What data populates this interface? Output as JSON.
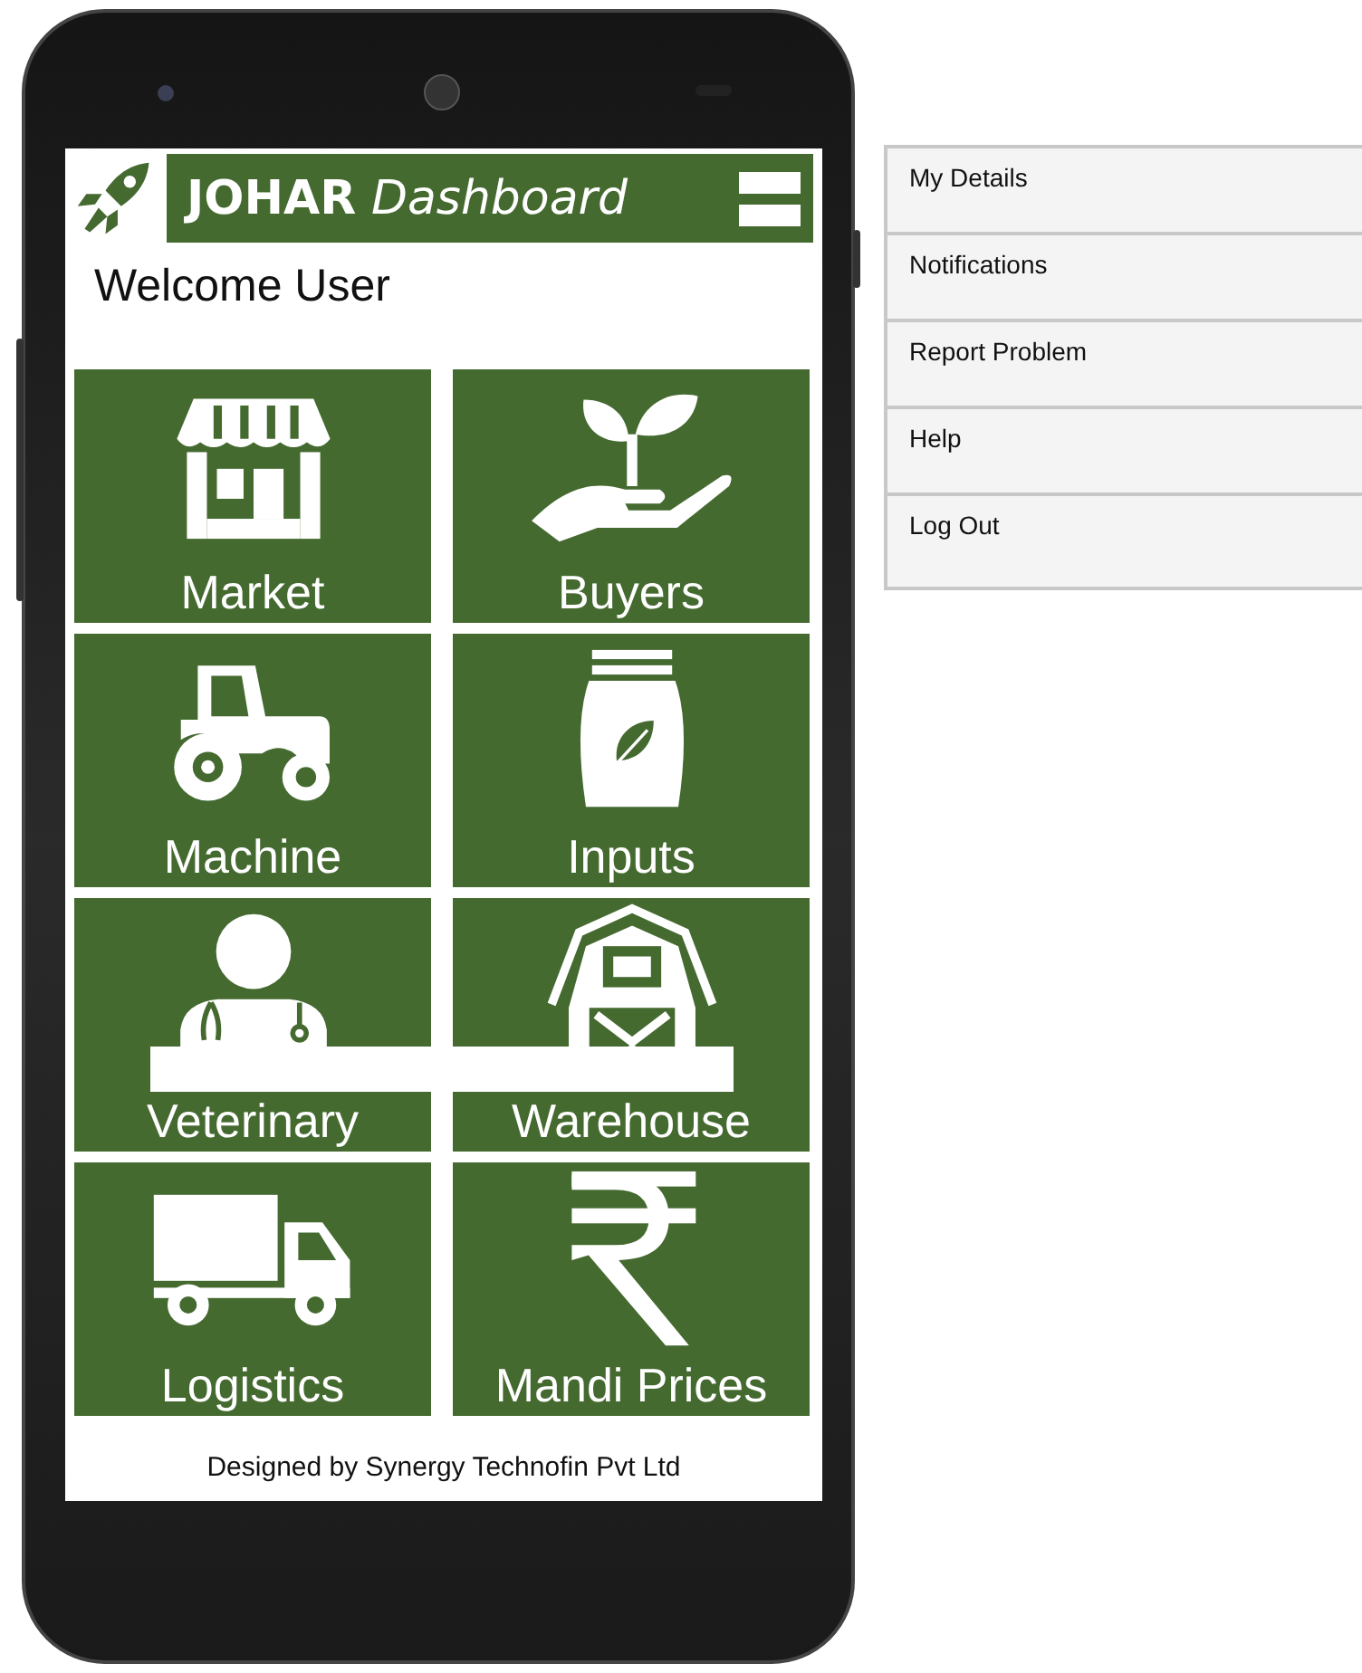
{
  "app_header": {
    "title": "**JOHAR** *Dashboard*"
  },
  "greeting": "Welcome User",
  "tiles": [
    {
      "label": "Market",
      "kind": "store"
    },
    {
      "label": "Buyers",
      "kind": "plant"
    },
    {
      "label": "Machine",
      "kind": "tractor"
    },
    {
      "label": "Inputs",
      "kind": "bag"
    },
    {
      "label": "Veterinary",
      "kind": "doctor"
    },
    {
      "label": "Warehouse",
      "kind": "barn"
    },
    {
      "label": "Logistics",
      "kind": "truck"
    },
    {
      "label": "Mandi Prices",
      "kind": "rupee"
    }
  ],
  "footer": "Designed by Synergy Technofin Pvt Ltd",
  "side_menu": {
    "items": [
      "My Details",
      "Notifications",
      "Report Problem",
      "Help",
      "Log Out"
    ]
  }
}
